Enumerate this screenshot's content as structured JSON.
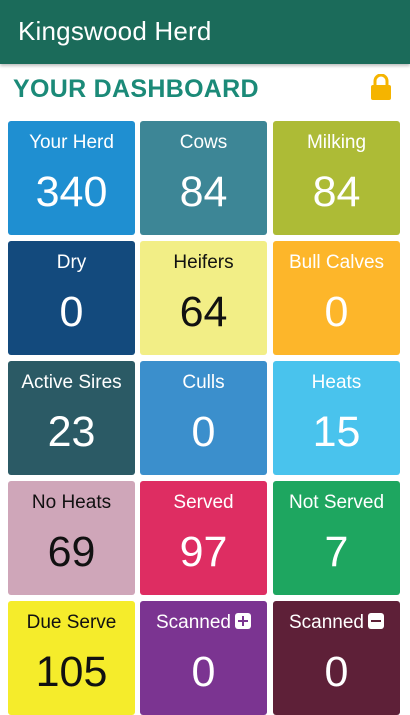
{
  "app_bar": {
    "title": "Kingswood Herd"
  },
  "dashboard": {
    "title": "YOUR DASHBOARD",
    "lock_icon": "lock-icon"
  },
  "tiles": [
    {
      "label": "Your Herd",
      "value": "340",
      "color": "#1f8fd1"
    },
    {
      "label": "Cows",
      "value": "84",
      "color": "#3d8696"
    },
    {
      "label": "Milking",
      "value": "84",
      "color": "#adbb36"
    },
    {
      "label": "Dry",
      "value": "0",
      "color": "#134a7d"
    },
    {
      "label": "Heifers",
      "value": "64",
      "color": "#f2ee86"
    },
    {
      "label": "Bull Calves",
      "value": "0",
      "color": "#fdb62a"
    },
    {
      "label": "Active Sires",
      "value": "23",
      "color": "#2b5a65"
    },
    {
      "label": "Culls",
      "value": "0",
      "color": "#3b8fcc"
    },
    {
      "label": "Heats",
      "value": "15",
      "color": "#49c3ed"
    },
    {
      "label": "No Heats",
      "value": "69",
      "color": "#cfa6b9"
    },
    {
      "label": "Served",
      "value": "97",
      "color": "#de2d62"
    },
    {
      "label": "Not Served",
      "value": "7",
      "color": "#1ea660"
    },
    {
      "label": "Due Serve",
      "value": "105",
      "color": "#f5ec2b"
    },
    {
      "label": "Scanned",
      "value": "0",
      "color": "#7b3491",
      "icon": "plus-square-icon"
    },
    {
      "label": "Scanned",
      "value": "0",
      "color": "#5e2038",
      "icon": "minus-square-icon"
    }
  ]
}
